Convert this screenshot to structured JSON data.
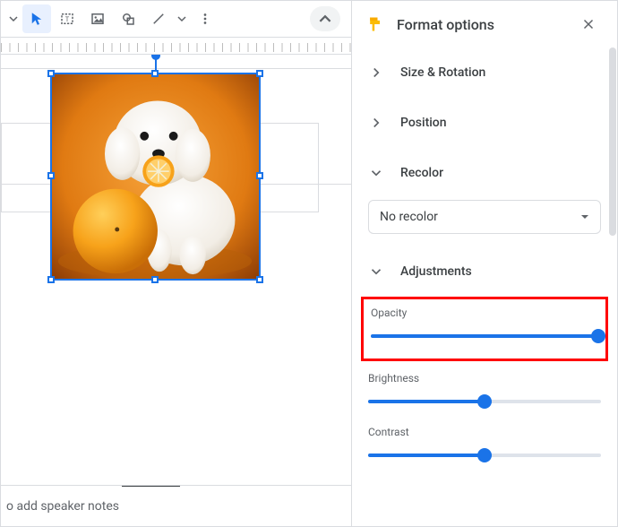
{
  "toolbar": {
    "icons": [
      "dropdown",
      "select",
      "textbox",
      "image",
      "shape",
      "line",
      "line-dropdown",
      "more-vert",
      "collapse-up"
    ]
  },
  "panel": {
    "title": "Format options",
    "sections": {
      "size_rotation": "Size & Rotation",
      "position": "Position",
      "recolor": "Recolor",
      "adjustments": "Adjustments"
    },
    "recolor_value": "No recolor",
    "sliders": {
      "opacity": {
        "label": "Opacity",
        "percent": 100
      },
      "brightness": {
        "label": "Brightness",
        "percent": 50
      },
      "contrast": {
        "label": "Contrast",
        "percent": 50
      }
    }
  },
  "speaker_prompt": "o add speaker notes"
}
